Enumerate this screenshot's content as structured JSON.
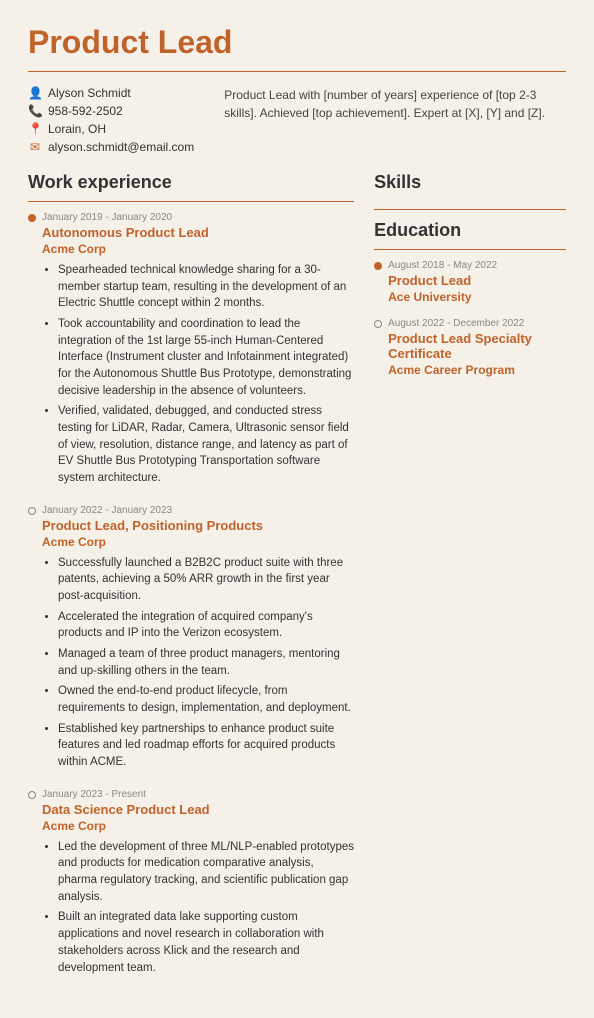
{
  "title": "Product Lead",
  "contact": {
    "name": "Alyson Schmidt",
    "phone": "958-592-2502",
    "location": "Lorain, OH",
    "email": "alyson.schmidt@email.com"
  },
  "summary": "Product Lead with [number of years] experience of [top 2-3 skills]. Achieved [top achievement]. Expert at [X], [Y] and [Z].",
  "work_experience_label": "Work experience",
  "skills_label": "Skills",
  "education_label": "Education",
  "jobs": [
    {
      "date": "January 2019 - January 2020",
      "title": "Autonomous Product Lead",
      "company": "Acme Corp",
      "filled": true,
      "bullets": [
        "Spearheaded technical knowledge sharing for a 30-member startup team, resulting in the development of an Electric Shuttle concept within 2 months.",
        "Took accountability and coordination to lead the integration of the 1st large 55-inch Human-Centered Interface (Instrument cluster and Infotainment integrated) for the Autonomous Shuttle Bus Prototype, demonstrating decisive leadership in the absence of volunteers.",
        "Verified, validated, debugged, and conducted stress testing for LiDAR, Radar, Camera, Ultrasonic sensor field of view, resolution, distance range, and latency as part of EV Shuttle Bus Prototyping Transportation software system architecture."
      ]
    },
    {
      "date": "January 2022 - January 2023",
      "title": "Product Lead, Positioning Products",
      "company": "Acme Corp",
      "filled": false,
      "bullets": [
        "Successfully launched a B2B2C product suite with three patents, achieving a 50% ARR growth in the first year post-acquisition.",
        "Accelerated the integration of acquired company's products and IP into the Verizon ecosystem.",
        "Managed a team of three product managers, mentoring and up-skilling others in the team.",
        "Owned the end-to-end product lifecycle, from requirements to design, implementation, and deployment.",
        "Established key partnerships to enhance product suite features and led roadmap efforts for acquired products within ACME."
      ]
    },
    {
      "date": "January 2023 - Present",
      "title": "Data Science Product Lead",
      "company": "Acme Corp",
      "filled": false,
      "bullets": [
        "Led the development of three ML/NLP-enabled prototypes and products for medication comparative analysis, pharma regulatory tracking, and scientific publication gap analysis.",
        "Built an integrated data lake supporting custom applications and novel research in collaboration with stakeholders across Klick and the research and development team."
      ]
    }
  ],
  "education": [
    {
      "date": "August 2018 - May 2022",
      "degree": "Product Lead",
      "school": "Ace University",
      "filled": true
    },
    {
      "date": "August 2022 - December 2022",
      "degree": "Product Lead Specialty Certificate",
      "school": "Acme Career Program",
      "filled": false
    }
  ]
}
